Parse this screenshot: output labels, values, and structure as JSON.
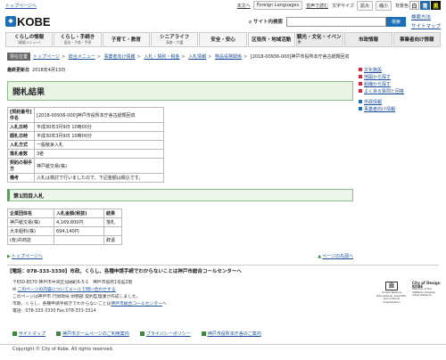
{
  "topbar": {
    "back": "トップページへ",
    "body": "本文へ",
    "lang_icon": "▼",
    "lang": "Foreign Languages",
    "voice": "音声で読む",
    "fontsize": "文字サイズ",
    "enlarge": "拡大",
    "reduce": "縮小",
    "bgcolor": "背景色",
    "bg_white": "白",
    "bg_blue": "青",
    "bg_black": "黒"
  },
  "header": {
    "logo": "KOBE",
    "search_label": "サイト内検索",
    "search_button": "検索",
    "links": [
      "検索方法",
      "サイトマップ"
    ]
  },
  "nav": [
    {
      "label": "くらしの情報",
      "sub": "［概要メニュー］"
    },
    {
      "label": "くらし・手続き",
      "sub": "届出・子育・手続"
    },
    {
      "label": "子育て・教育",
      "sub": ""
    },
    {
      "label": "シニアライフ",
      "sub": "高齢・介護"
    },
    {
      "label": "安全・安心",
      "sub": ""
    },
    {
      "label": "区役所・地域活動",
      "sub": ""
    },
    {
      "label": "観光・文化・イベント",
      "sub": ""
    },
    {
      "label": "市政情報",
      "sub": ""
    },
    {
      "label": "事業者向け情報",
      "sub": ""
    }
  ],
  "breadcrumb": {
    "label": "現在位置",
    "items": [
      "トップページ",
      "総合メニュー",
      "事業者向け情報",
      "入札・契約・税金",
      "入札情報",
      "物品役務関係",
      "[2018-00936-000]神戸市役所本庁舎古紙類回収"
    ]
  },
  "updated": {
    "label": "最終更新日",
    "date": "2018年4月13日"
  },
  "title": "開札結果",
  "info": [
    {
      "k": "[契約番号]件名",
      "v": "[2018-00936-000]神戸市役所本庁舎古紙類回収"
    },
    {
      "k": "入札日時",
      "v": "平成30年3月9日 10時00分"
    },
    {
      "k": "開札日時",
      "v": "平成30年3月9日 10時00分"
    },
    {
      "k": "入札方式",
      "v": "一般競争入札"
    },
    {
      "k": "落札者数",
      "v": "3者"
    },
    {
      "k": "契約の相手方",
      "v": "神戸紙交易(株)"
    },
    {
      "k": "備考",
      "v": "入札は検討で行いましたので、下記金額は税込です。"
    }
  ],
  "round_heading": "第1回目入札",
  "bids": {
    "headers": [
      "企業団体名",
      "入札金額(税抜)",
      "結果"
    ],
    "rows": [
      [
        "神戸紙交易(株)",
        "4,169,800円",
        "落札"
      ],
      [
        "大本組料(株)",
        "694,140円",
        ""
      ],
      [
        "(有)弁商店",
        "",
        "辞退"
      ]
    ]
  },
  "pagenav": {
    "top": "トップページへ",
    "up": "ページの先頭へ"
  },
  "sidebar": {
    "group1": [
      "文化施設",
      "地図から探す",
      "組織から探す",
      "よくある質問と回答"
    ],
    "group2": [
      "市政情報",
      "事業者向け情報"
    ]
  },
  "footer": {
    "call": "【電話：078-333-3330】市政、くらし、各種申請手続でわからないことは神戸市総合コールセンターへ",
    "address": "〒650-8570 神戸市中央区加納町6-5-1　神戸市役所1号館2階",
    "inquiry_link": "このページの内容についてメールで問い合わせする",
    "inquiry_dept": "このページは神戸市 行財政局 財務部 契約監理課が作成しました。",
    "center_prefix": "市政、くらし、各種申請手続きでわからないことは",
    "center_link": "神戸市総合コールセンター",
    "center_suffix": "へ",
    "tel": "電話：078-333-3330 Fax:078-333-3314",
    "unesco_text": "United Nations Educational, Scientific and Cultural Organization",
    "unesco_sub": "Member of the UNESCO Creative Cities Network",
    "city_of_design": "City of Design KOBE",
    "links": [
      "サイトマップ",
      "神戸市ホームページのご利用案内",
      "プライバシーポリシー",
      "神戸市役所本庁舎のご案内"
    ],
    "copyright": "Copyright © City of Kobe. All rights reserved."
  }
}
